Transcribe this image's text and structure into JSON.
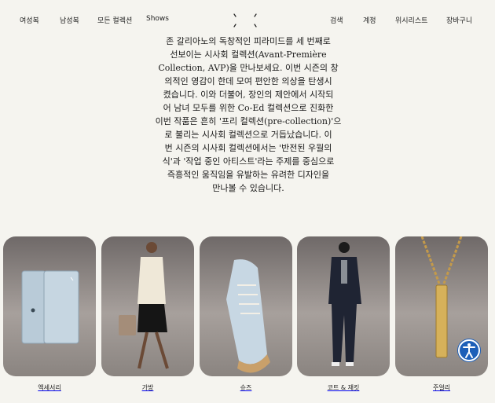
{
  "nav": {
    "left": [
      "여성복",
      "남성복",
      "모든 컬렉션",
      "Shows"
    ],
    "right": [
      "검색",
      "계정",
      "위시리스트",
      "장바구니"
    ]
  },
  "intro": {
    "lines": [
      "존 갈리아노의 독창적인 피라미드를 세 번째로",
      "선보이는 시사회 컬렉션(Avant-Première",
      "Collection, AVP)을 만나보세요. 이번 시즌의 창",
      "의적인 영감이 한데 모여 편안한 의상을 탄생시",
      "켰습니다. 이와 더불어, 장인의 제안에서 시작되",
      "어 남녀 모두를 위한 Co-Ed 컬렉션으로 진화한",
      "이번 작품은 흔히 '프리 컬렉션(pre-collection)'으",
      "로 불리는 시사회 컬렉션으로 거듭났습니다. 이",
      "번 시즌의 시사회 컬렉션에서는 '반전된 우월의",
      "식'과 '작업 중인 아티스트'라는 주제를 중심으로",
      "즉흥적인 움직임을 유발하는 유려한 디자인을",
      "만나볼 수 있습니다."
    ]
  },
  "categories": [
    {
      "label": "액세서리"
    },
    {
      "label": "가방"
    },
    {
      "label": "슈즈"
    },
    {
      "label": "코트 & 재킷"
    },
    {
      "label": "주얼리"
    }
  ],
  "colors": {
    "background": "#f5f4ef",
    "tile_gradient_top": "#6f6968",
    "tile_gradient_mid": "#a7a09c",
    "accessibility_blue": "#1d5fb8"
  },
  "icons": [
    "logo-stitches-icon",
    "accessibility-icon"
  ]
}
